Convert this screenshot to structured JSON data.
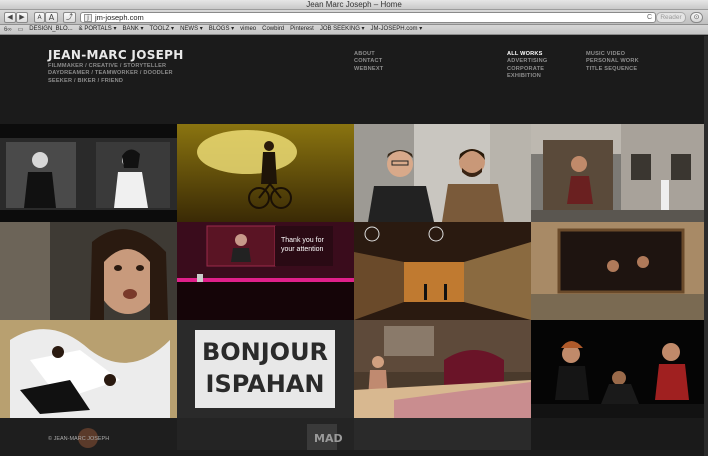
{
  "window": {
    "title": "Jean Marc Joseph – Home"
  },
  "toolbar": {
    "back_label": "◀",
    "forward_label": "▶",
    "font_small_label": "A",
    "font_large_label": "A",
    "share_label": "⤴",
    "url": "jm-joseph.com",
    "reload_label": "C",
    "reader_label": "Reader",
    "downloads_label": "⊙"
  },
  "bookmarks": [
    {
      "label": "DESIGN_BLO..."
    },
    {
      "label": "& PORTALS ▾"
    },
    {
      "label": "BANK ▾"
    },
    {
      "label": "TOOLZ ▾"
    },
    {
      "label": "NEWS ▾"
    },
    {
      "label": "BLOGS ▾"
    },
    {
      "label": "vimeo"
    },
    {
      "label": "Cowbird"
    },
    {
      "label": "Pinterest"
    },
    {
      "label": "JOB SEEKING ▾"
    },
    {
      "label": "JM-JOSEPH.com ▾"
    }
  ],
  "site": {
    "brand": "JEAN-MARC JOSEPH",
    "tagline": [
      "FILMMAKER / CREATIVE / STORYTELLER",
      "DAYDREAMER / TEAMWORKER / DOODLER",
      "SEEKER / BIKER / FRIEND"
    ],
    "nav_info": [
      "ABOUT",
      "CONTACT",
      "WEBNEXT"
    ],
    "nav_work": [
      "ALL WORKS",
      "ADVERTISING",
      "CORPORATE",
      "EXHIBITION"
    ],
    "nav_more": [
      "MUSIC VIDEO",
      "PERSONAL WORK",
      "TITLE SEQUENCE"
    ],
    "tile_texts": {
      "thank_you_1": "Thank you for",
      "thank_you_2": "your attention",
      "bonjour": "BONJOUR",
      "ispahan": "ISPAHAN"
    },
    "footer_copy": "© JEAN-MARC JOSEPH",
    "footer_mad": "MAD"
  },
  "colors": {
    "background": "#1b1b1b",
    "accent": "#ffffff",
    "muted": "#8e8e8e"
  }
}
